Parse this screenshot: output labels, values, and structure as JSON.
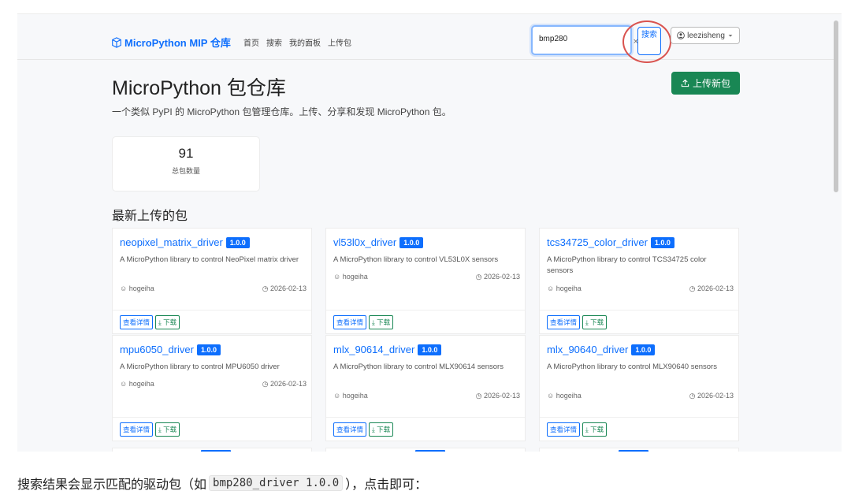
{
  "navbar": {
    "brand": "MicroPython MIP 仓库",
    "links": [
      "首页",
      "搜索",
      "我的面板",
      "上传包"
    ],
    "search_value": "bmp280",
    "search_clear": "×",
    "search_button": "搜索",
    "user": "leezisheng"
  },
  "hero": {
    "title": "MicroPython 包仓库",
    "subtitle": "一个类似 PyPI 的 MicroPython 包管理仓库。上传、分享和发现 MicroPython 包。",
    "upload_button": "上传新包"
  },
  "stats": {
    "value": "91",
    "label": "总包数量"
  },
  "section_title": "最新上传的包",
  "cards": [
    {
      "name": "neopixel_matrix_driver",
      "version": "1.0.0",
      "description": "A MicroPython library to control NeoPixel matrix driver",
      "author": "hogeiha",
      "date": "2026-02-13",
      "detail": "查看详情",
      "download": "下载"
    },
    {
      "name": "vl53l0x_driver",
      "version": "1.0.0",
      "description": "A MicroPython library to control VL53L0X sensors",
      "author": "hogeiha",
      "date": "2026-02-13",
      "detail": "查看详情",
      "download": "下载"
    },
    {
      "name": "tcs34725_color_driver",
      "version": "1.0.0",
      "description": "A MicroPython library to control TCS34725 color sensors",
      "author": "hogeiha",
      "date": "2026-02-13",
      "detail": "查看详情",
      "download": "下载"
    },
    {
      "name": "mpu6050_driver",
      "version": "1.0.0",
      "description": "A MicroPython library to control MPU6050 driver",
      "author": "hogeiha",
      "date": "2026-02-13",
      "detail": "查看详情",
      "download": "下载"
    },
    {
      "name": "mlx_90614_driver",
      "version": "1.0.0",
      "description": "A MicroPython library to control MLX90614 sensors",
      "author": "hogeiha",
      "date": "2026-02-13",
      "detail": "查看详情",
      "download": "下载"
    },
    {
      "name": "mlx_90640_driver",
      "version": "1.0.0",
      "description": "A MicroPython library to control MLX90640 sensors",
      "author": "hogeiha",
      "date": "2026-02-13",
      "detail": "查看详情",
      "download": "下载"
    }
  ],
  "caption": {
    "before": "搜索结果会显示匹配的驱动包（如",
    "code": "bmp280_driver 1.0.0",
    "after": "），点击即可："
  },
  "colors": {
    "primary": "#0d6efd",
    "success": "#198754",
    "highlight_circle": "#d9534f"
  }
}
